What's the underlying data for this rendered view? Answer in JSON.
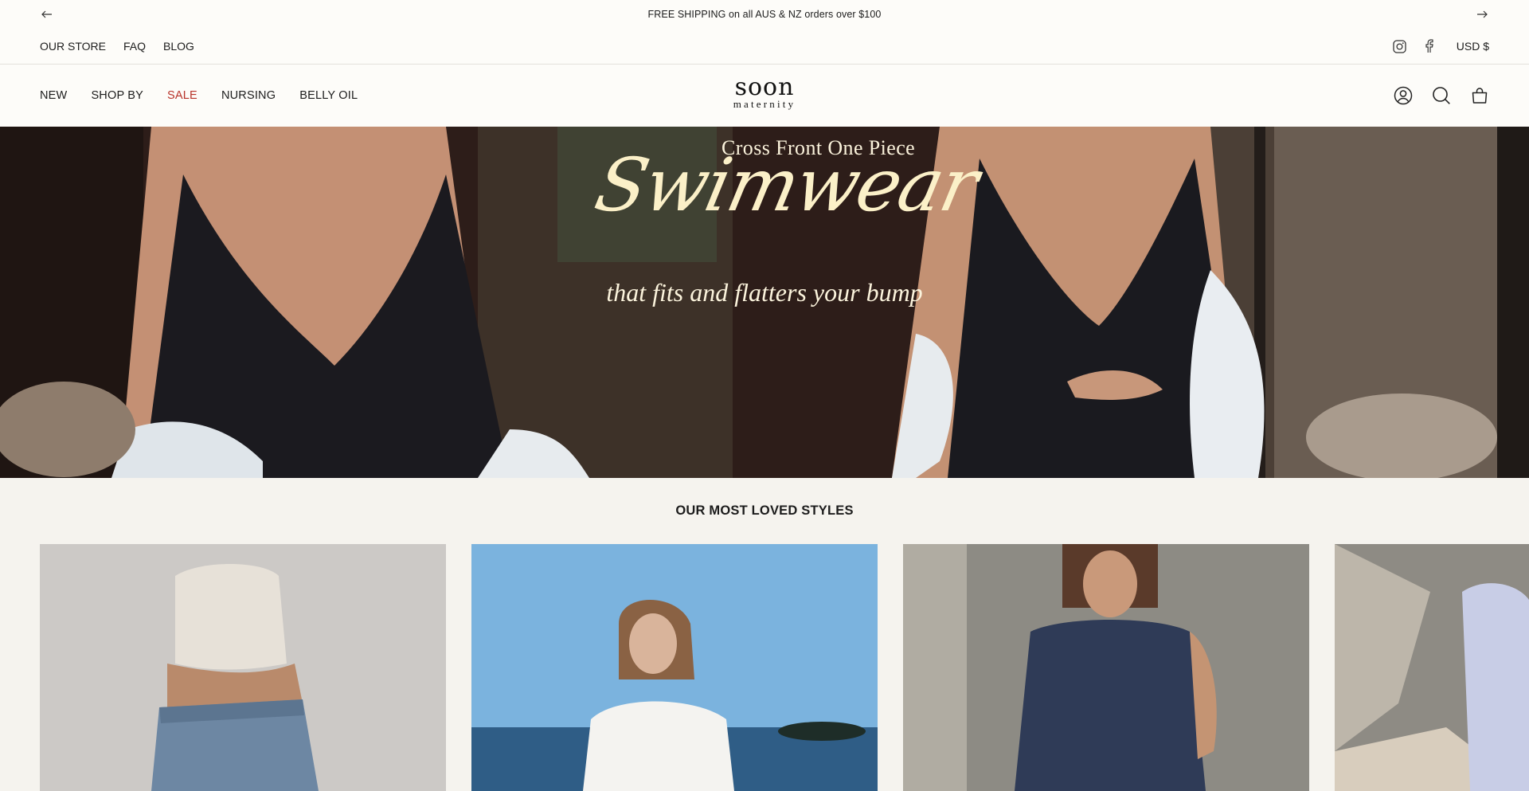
{
  "announcement": {
    "text": "FREE SHIPPING on all AUS & NZ orders over $100",
    "prev_icon": "arrow-left-icon",
    "next_icon": "arrow-right-icon"
  },
  "utility": {
    "links": [
      "OUR STORE",
      "FAQ",
      "BLOG"
    ],
    "social": [
      "instagram-icon",
      "facebook-icon"
    ],
    "currency": "USD $"
  },
  "header": {
    "nav": [
      {
        "label": "NEW",
        "sale": false
      },
      {
        "label": "SHOP BY",
        "sale": false
      },
      {
        "label": "SALE",
        "sale": true
      },
      {
        "label": "NURSING",
        "sale": false
      },
      {
        "label": "BELLY OIL",
        "sale": false
      }
    ],
    "logo_line1": "soon",
    "logo_line2": "maternity",
    "icons": [
      "account-icon",
      "search-icon",
      "cart-icon"
    ]
  },
  "hero": {
    "subtitle_top": "Cross Front One Piece",
    "script_title": "Swimwear",
    "subtitle_bottom": "that fits and flatters your bump"
  },
  "section": {
    "title": "OUR MOST LOVED STYLES"
  },
  "colors": {
    "sale": "#b8332a",
    "page_bg": "#f5f3ee",
    "header_bg": "#fdfcf9",
    "hero_text": "#fbf3dc"
  }
}
